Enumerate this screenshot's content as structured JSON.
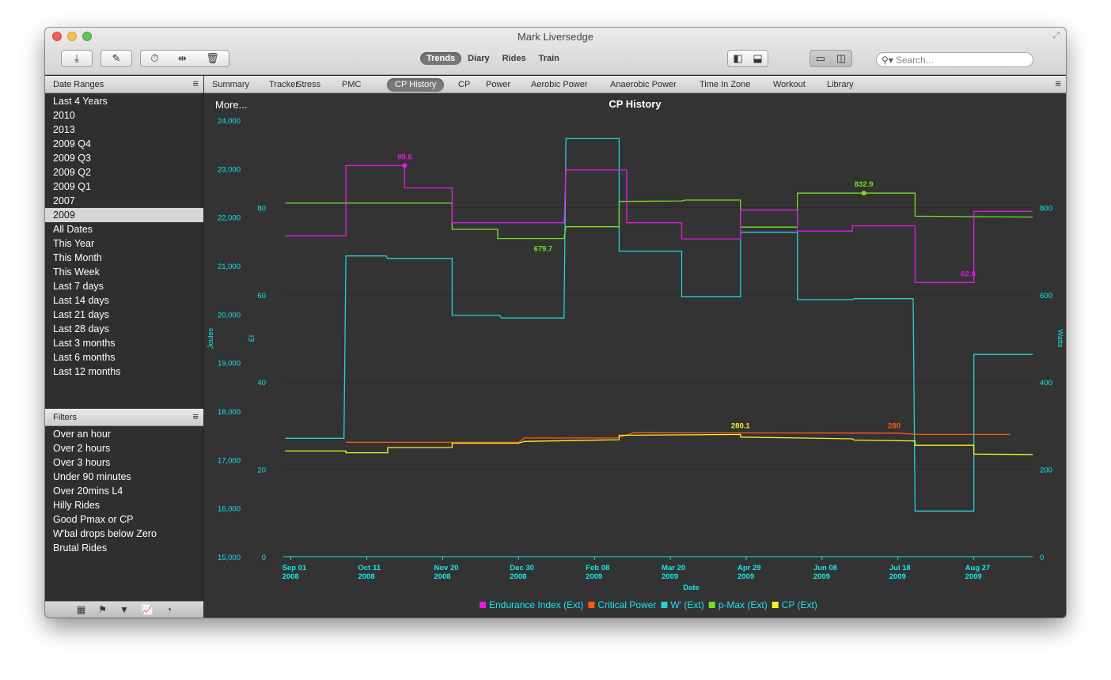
{
  "window": {
    "title": "Mark Liversedge"
  },
  "toolbar": {
    "view_tabs": [
      {
        "label": "Trends",
        "active": true
      },
      {
        "label": "Diary",
        "active": false
      },
      {
        "label": "Rides",
        "active": false
      },
      {
        "label": "Train",
        "active": false
      }
    ],
    "search_placeholder": "Search..."
  },
  "sidebar": {
    "date_ranges_header": "Date Ranges",
    "date_ranges": [
      {
        "label": "Last 4 Years",
        "selected": false
      },
      {
        "label": "2010",
        "selected": false
      },
      {
        "label": "2013",
        "selected": false
      },
      {
        "label": "2009 Q4",
        "selected": false
      },
      {
        "label": "2009 Q3",
        "selected": false
      },
      {
        "label": "2009 Q2",
        "selected": false
      },
      {
        "label": "2009 Q1",
        "selected": false
      },
      {
        "label": "2007",
        "selected": false
      },
      {
        "label": "2009",
        "selected": true
      },
      {
        "label": "All Dates",
        "selected": false
      },
      {
        "label": "This Year",
        "selected": false
      },
      {
        "label": "This Month",
        "selected": false
      },
      {
        "label": "This Week",
        "selected": false
      },
      {
        "label": "Last 7 days",
        "selected": false
      },
      {
        "label": "Last 14 days",
        "selected": false
      },
      {
        "label": "Last 21 days",
        "selected": false
      },
      {
        "label": "Last 28 days",
        "selected": false
      },
      {
        "label": "Last 3 months",
        "selected": false
      },
      {
        "label": "Last 6 months",
        "selected": false
      },
      {
        "label": "Last 12 months",
        "selected": false
      }
    ],
    "filters_header": "Filters",
    "filters": [
      "Over an hour",
      "Over 2 hours",
      "Over 3 hours",
      "Under 90 minutes",
      "Over 20mins L4",
      "Hilly Rides",
      "Good Pmax or CP",
      "W'bal drops below Zero",
      "Brutal Rides"
    ]
  },
  "chart_tabs": [
    {
      "label": "Summary",
      "active": false
    },
    {
      "label": "Tracker",
      "active": false
    },
    {
      "label": "Stress",
      "active": false
    },
    {
      "label": "PMC",
      "active": false
    },
    {
      "label": "CP History",
      "active": true
    },
    {
      "label": "CP",
      "active": false
    },
    {
      "label": "Power",
      "active": false
    },
    {
      "label": "Aerobic Power",
      "active": false
    },
    {
      "label": "Anaerobic Power",
      "active": false
    },
    {
      "label": "Time In Zone",
      "active": false
    },
    {
      "label": "Workout",
      "active": false
    },
    {
      "label": "Library",
      "active": false
    }
  ],
  "chart_panel": {
    "more_label": "More..."
  },
  "colors": {
    "endurance": "#e21be4",
    "critical_power": "#ff5a10",
    "wprime": "#24cfd8",
    "pmax": "#6fe323",
    "cp": "#f3f324",
    "axis": "#15e8f0",
    "background": "#333333"
  },
  "chart_data": {
    "type": "line",
    "title": "CP History",
    "xlabel": "Date",
    "x_ticks": [
      {
        "date": "2008-09-01",
        "label": "Sep 01",
        "year": "2008"
      },
      {
        "date": "2008-10-11",
        "label": "Oct 11",
        "year": "2008"
      },
      {
        "date": "2008-11-20",
        "label": "Nov 20",
        "year": "2008"
      },
      {
        "date": "2008-12-30",
        "label": "Dec 30",
        "year": "2008"
      },
      {
        "date": "2009-02-08",
        "label": "Feb 08",
        "year": "2009"
      },
      {
        "date": "2009-03-20",
        "label": "Mar 20",
        "year": "2009"
      },
      {
        "date": "2009-04-29",
        "label": "Apr 29",
        "year": "2009"
      },
      {
        "date": "2009-06-08",
        "label": "Jun 08",
        "year": "2009"
      },
      {
        "date": "2009-07-18",
        "label": "Jul 18",
        "year": "2009"
      },
      {
        "date": "2009-08-27",
        "label": "Aug 27",
        "year": "2009"
      }
    ],
    "xlim": [
      "2008-08-28",
      "2009-09-27"
    ],
    "axes": {
      "joules": {
        "label": "Joules",
        "lim": [
          15000,
          24000
        ],
        "ticks": [
          15000,
          16000,
          17000,
          18000,
          19000,
          20000,
          21000,
          22000,
          23000,
          24000
        ],
        "tick_labels": [
          "15,000",
          "16,000",
          "17,000",
          "18,000",
          "19,000",
          "20,000",
          "21,000",
          "22,000",
          "23,000",
          "24,000"
        ]
      },
      "ei": {
        "label": "EI",
        "lim": [
          0,
          100
        ],
        "ticks": [
          0,
          20,
          40,
          60,
          80
        ],
        "tick_labels": [
          "0",
          "20",
          "40",
          "60",
          "80"
        ]
      },
      "watts": {
        "label": "Watts",
        "lim": [
          0,
          1000
        ],
        "ticks": [
          0,
          200,
          400,
          600,
          800
        ],
        "tick_labels": [
          "0",
          "200",
          "400",
          "600",
          "800"
        ]
      }
    },
    "series": [
      {
        "name": "Endurance Index (Ext)",
        "axis": "ei",
        "color_key": "endurance",
        "points": [
          [
            "2008-08-29",
            73.5
          ],
          [
            "2008-09-30",
            73.5
          ],
          [
            "2008-09-30",
            89.6
          ],
          [
            "2008-10-31",
            89.6
          ],
          [
            "2008-10-31",
            84.5
          ],
          [
            "2008-11-25",
            84.5
          ],
          [
            "2008-11-25",
            76.5
          ],
          [
            "2009-01-23",
            76.5
          ],
          [
            "2009-01-24",
            88.6
          ],
          [
            "2009-02-25",
            88.6
          ],
          [
            "2009-02-25",
            76.5
          ],
          [
            "2009-03-26",
            76.5
          ],
          [
            "2009-03-26",
            72.8
          ],
          [
            "2009-04-26",
            72.8
          ],
          [
            "2009-04-26",
            79.4
          ],
          [
            "2009-05-26",
            79.4
          ],
          [
            "2009-05-26",
            74.6
          ],
          [
            "2009-06-24",
            74.6
          ],
          [
            "2009-06-24",
            75.8
          ],
          [
            "2009-07-27",
            75.8
          ],
          [
            "2009-07-27",
            62.8
          ],
          [
            "2009-08-27",
            62.8
          ],
          [
            "2009-08-27",
            79.1
          ],
          [
            "2009-09-27",
            79.1
          ]
        ]
      },
      {
        "name": "Critical Power",
        "axis": "watts",
        "color_key": "critical_power",
        "points": [
          [
            "2008-09-30",
            262
          ],
          [
            "2008-12-30",
            262
          ],
          [
            "2009-01-02",
            272
          ],
          [
            "2009-02-20",
            272
          ],
          [
            "2009-03-01",
            284
          ],
          [
            "2009-07-18",
            283
          ],
          [
            "2009-07-28",
            280
          ],
          [
            "2009-09-15",
            280
          ]
        ]
      },
      {
        "name": "W' (Ext)",
        "axis": "joules",
        "color_key": "wprime",
        "points": [
          [
            "2008-08-29",
            17440
          ],
          [
            "2008-09-29",
            17440
          ],
          [
            "2008-09-30",
            21200
          ],
          [
            "2008-10-21",
            21200
          ],
          [
            "2008-10-22",
            21150
          ],
          [
            "2008-11-25",
            21150
          ],
          [
            "2008-11-25",
            19980
          ],
          [
            "2008-12-20",
            19980
          ],
          [
            "2008-12-21",
            19920
          ],
          [
            "2009-01-23",
            19920
          ],
          [
            "2009-01-24",
            23620
          ],
          [
            "2009-02-21",
            23620
          ],
          [
            "2009-02-21",
            21300
          ],
          [
            "2009-03-26",
            21300
          ],
          [
            "2009-03-26",
            20360
          ],
          [
            "2009-04-26",
            20360
          ],
          [
            "2009-04-26",
            21690
          ],
          [
            "2009-05-26",
            21690
          ],
          [
            "2009-05-26",
            20300
          ],
          [
            "2009-06-24",
            20300
          ],
          [
            "2009-06-25",
            20320
          ],
          [
            "2009-07-26",
            20320
          ],
          [
            "2009-07-27",
            15940
          ],
          [
            "2009-08-27",
            15940
          ],
          [
            "2009-08-27",
            19170
          ],
          [
            "2009-09-27",
            19170
          ]
        ]
      },
      {
        "name": "p-Max (Ext)",
        "axis": "watts",
        "color_key": "pmax",
        "points": [
          [
            "2008-08-29",
            810
          ],
          [
            "2008-11-25",
            810
          ],
          [
            "2008-11-25",
            750
          ],
          [
            "2008-12-19",
            750
          ],
          [
            "2008-12-19",
            729
          ],
          [
            "2009-01-23",
            729
          ],
          [
            "2009-01-24",
            756
          ],
          [
            "2009-02-21",
            756
          ],
          [
            "2009-02-21",
            814
          ],
          [
            "2009-03-26",
            815
          ],
          [
            "2009-03-28",
            817
          ],
          [
            "2009-04-26",
            817
          ],
          [
            "2009-04-26",
            755
          ],
          [
            "2009-05-26",
            755
          ],
          [
            "2009-05-26",
            832.9
          ],
          [
            "2009-07-27",
            832.9
          ],
          [
            "2009-07-27",
            780
          ],
          [
            "2009-08-27",
            779
          ],
          [
            "2009-09-27",
            778
          ]
        ]
      },
      {
        "name": "CP (Ext)",
        "axis": "watts",
        "color_key": "cp",
        "points": [
          [
            "2008-08-29",
            242
          ],
          [
            "2008-09-30",
            242
          ],
          [
            "2008-09-30",
            238
          ],
          [
            "2008-10-22",
            238
          ],
          [
            "2008-10-22",
            250
          ],
          [
            "2008-11-25",
            250
          ],
          [
            "2008-11-25",
            260
          ],
          [
            "2008-12-30",
            260
          ],
          [
            "2009-01-02",
            264
          ],
          [
            "2009-02-21",
            268
          ],
          [
            "2009-02-21",
            278
          ],
          [
            "2009-04-26",
            280.1
          ],
          [
            "2009-04-26",
            274
          ],
          [
            "2009-05-26",
            272
          ],
          [
            "2009-06-24",
            270
          ],
          [
            "2009-06-25",
            267
          ],
          [
            "2009-07-27",
            265
          ],
          [
            "2009-07-27",
            255
          ],
          [
            "2009-08-27",
            255
          ],
          [
            "2009-08-27",
            235
          ],
          [
            "2009-09-27",
            234
          ]
        ]
      }
    ],
    "annotations": [
      {
        "series": "Endurance Index (Ext)",
        "label": "89.6",
        "date": "2008-10-31",
        "value": 89.6,
        "dot": true
      },
      {
        "series": "Endurance Index (Ext)",
        "label": "62.8",
        "date": "2009-08-24",
        "value": 62.8,
        "dot": false
      },
      {
        "series": "p-Max (Ext)",
        "label": "679.7",
        "date": "2009-01-12",
        "value": 729,
        "dot": false
      },
      {
        "series": "p-Max (Ext)",
        "label": "832.9",
        "date": "2009-06-30",
        "value": 832.9,
        "dot": true
      },
      {
        "series": "CP (Ext)",
        "label": "280.1",
        "date": "2009-04-26",
        "value": 280.1,
        "dot": false
      },
      {
        "series": "Critical Power",
        "label": "280",
        "date": "2009-07-16",
        "value": 280,
        "dot": false
      }
    ],
    "legend_position": "bottom"
  }
}
